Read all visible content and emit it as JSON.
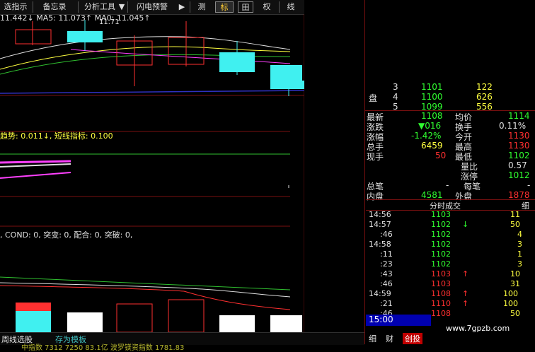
{
  "toolbar": {
    "items": [
      "选指示",
      "备忘录",
      "分析工具",
      "▼",
      "闪电预警",
      "▶",
      "测",
      "标",
      "田",
      "权",
      "线"
    ]
  },
  "main_chart": {
    "ma_line": "11.442↓  MA5: 11.073↑  MA0: 11.045↑",
    "price_label": "11.71"
  },
  "trend_indicator": {
    "label": "趋势: 0.011↓, 短线指标: 0.100"
  },
  "signal_indicator": {
    "label": ", COND: 0, 突变: 0, 配合: 0, 突破: 0,"
  },
  "bottom_tabs": {
    "tab1": "周线选股",
    "tab2": "存为模板",
    "ticker": "中指数  7312  7250   83.1亿  波罗镁资指数   1781.83"
  },
  "order_book": [
    {
      "label": "",
      "level": "3",
      "price": "1101",
      "vol": "122"
    },
    {
      "label": "盘",
      "level": "4",
      "price": "1100",
      "vol": "626"
    },
    {
      "label": "",
      "level": "5",
      "price": "1099",
      "vol": "556"
    }
  ],
  "quote": {
    "rows": [
      {
        "l1": "最新",
        "v1": "1108",
        "l2": "均价",
        "v2": "1114"
      },
      {
        "l1": "涨跌",
        "v1": "▼016",
        "l2": "换手",
        "v2": "0.11%"
      },
      {
        "l1": "涨幅",
        "v1": "-1.42%",
        "l2": "今开",
        "v2": "1130"
      },
      {
        "l1": "总手",
        "v1": "6459",
        "l2": "最高",
        "v2": "1130"
      },
      {
        "l1": "现手",
        "v1": "50",
        "l2": "最低",
        "v2": "1102"
      },
      {
        "l1": "",
        "v1": "",
        "l2": "量比",
        "v2": "0.57"
      },
      {
        "l1": "",
        "v1": "",
        "l2": "涨停",
        "v2": "1012"
      },
      {
        "l1": "总笔",
        "v1": "-",
        "l2": "每笔",
        "v2": "-"
      },
      {
        "l1": "内盘",
        "v1": "4581",
        "l2": "外盘",
        "v2": "1878"
      }
    ]
  },
  "trades": {
    "header": "分时成交",
    "header_right": "细",
    "rows": [
      {
        "time": "14:56",
        "price": "1103",
        "arrow": "",
        "vol": "11"
      },
      {
        "time": "14:57",
        "price": "1102",
        "arrow": "↓",
        "vol": "50"
      },
      {
        "time": ":46",
        "price": "1102",
        "arrow": "",
        "vol": "4"
      },
      {
        "time": "14:58",
        "price": "1102",
        "arrow": "",
        "vol": "3"
      },
      {
        "time": ":11",
        "price": "1102",
        "arrow": "",
        "vol": "1"
      },
      {
        "time": ":23",
        "price": "1102",
        "arrow": "",
        "vol": "3"
      },
      {
        "time": ":43",
        "price": "1103",
        "arrow": "↑",
        "vol": "10"
      },
      {
        "time": ":46",
        "price": "1103",
        "arrow": "",
        "vol": "31"
      },
      {
        "time": "14:59",
        "price": "1108",
        "arrow": "↑",
        "vol": "100"
      },
      {
        "time": ":21",
        "price": "1110",
        "arrow": "↑",
        "vol": "100"
      },
      {
        "time": ":46",
        "price": "1108",
        "arrow": "",
        "vol": "50"
      }
    ],
    "final_time": "15:00"
  },
  "right_bottom_tabs": [
    "细",
    "财",
    "创投"
  ],
  "watermark": "www.7gpzb.com",
  "colors": {
    "up": "#ff3030",
    "down": "#40f0f0",
    "accent": "#ffff40"
  }
}
